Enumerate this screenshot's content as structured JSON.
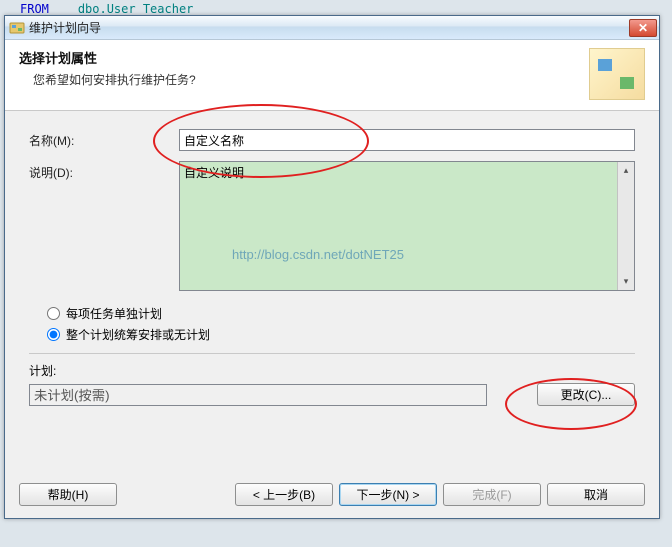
{
  "bg_code": {
    "keyword": "FROM",
    "table": "dbo.User_Teacher"
  },
  "titlebar": {
    "title": "维护计划向导"
  },
  "header": {
    "title": "选择计划属性",
    "subtitle": "您希望如何安排执行维护任务?"
  },
  "form": {
    "name_label": "名称(M):",
    "name_value": "自定义名称",
    "desc_label": "说明(D):",
    "desc_value": "自定义说明"
  },
  "watermark": "http://blog.csdn.net/dotNET25",
  "radios": {
    "opt1": "每项任务单独计划",
    "opt2": "整个计划统筹安排或无计划"
  },
  "plan": {
    "label": "计划:",
    "value": "未计划(按需)",
    "change_btn": "更改(C)..."
  },
  "footer": {
    "help": "帮助(H)",
    "back": "< 上一步(B)",
    "next": "下一步(N) >",
    "finish": "完成(F)",
    "cancel": "取消"
  }
}
